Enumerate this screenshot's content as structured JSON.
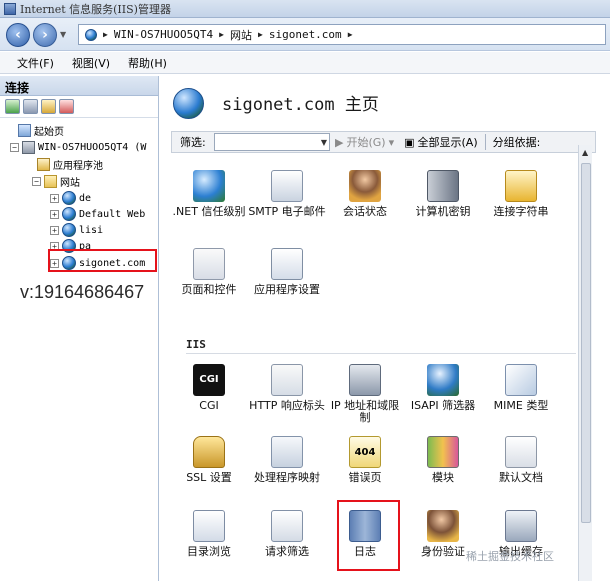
{
  "window": {
    "title": "Internet 信息服务(IIS)管理器"
  },
  "address": {
    "crumbs": [
      "WIN-OS7HUOO5QT4",
      "网站",
      "sigonet.com"
    ]
  },
  "menu": [
    "文件(F)",
    "视图(V)",
    "帮助(H)"
  ],
  "connections": {
    "title": "连接",
    "tree": [
      {
        "label": "起始页",
        "icon": "start-page-icon"
      },
      {
        "label": "WIN-OS7HUOO5QT4 (W",
        "icon": "server-icon"
      },
      {
        "label": "应用程序池",
        "icon": "app-pool-icon"
      },
      {
        "label": "网站",
        "icon": "sites-folder-icon"
      },
      {
        "label": "de",
        "icon": "globe-icon"
      },
      {
        "label": "Default Web",
        "icon": "globe-icon"
      },
      {
        "label": "lisi",
        "icon": "globe-icon"
      },
      {
        "label": "pa",
        "icon": "globe-icon"
      },
      {
        "label": "sigonet.com",
        "icon": "globe-icon"
      }
    ]
  },
  "watermark": "v:19164686467",
  "page": {
    "title": "sigonet.com 主页"
  },
  "filter": {
    "label": "筛选:",
    "start": "开始(G)",
    "show_all": "全部显示(A)",
    "group_by": "分组依据:"
  },
  "aspnet_features": [
    {
      "label": ".NET 信任级别",
      "icon": "trust-level-icon"
    },
    {
      "label": "SMTP 电子邮件",
      "icon": "smtp-email-icon"
    },
    {
      "label": "会话状态",
      "icon": "session-state-icon"
    },
    {
      "label": "计算机密钥",
      "icon": "machine-key-icon"
    },
    {
      "label": "连接字符串",
      "icon": "connection-strings-icon"
    },
    {
      "label": "页面和控件",
      "icon": "pages-controls-icon"
    },
    {
      "label": "应用程序设置",
      "icon": "app-settings-icon"
    }
  ],
  "iis_section": "IIS",
  "iis_features": [
    {
      "label": "CGI",
      "icon": "cgi-icon"
    },
    {
      "label": "HTTP 响应标头",
      "icon": "http-headers-icon"
    },
    {
      "label": "IP 地址和域限制",
      "icon": "ip-restrictions-icon"
    },
    {
      "label": "ISAPI 筛选器",
      "icon": "isapi-filter-icon"
    },
    {
      "label": "MIME 类型",
      "icon": "mime-types-icon"
    },
    {
      "label": "SSL 设置",
      "icon": "ssl-lock-icon"
    },
    {
      "label": "处理程序映射",
      "icon": "handler-mappings-icon"
    },
    {
      "label": "错误页",
      "icon": "error-pages-icon"
    },
    {
      "label": "模块",
      "icon": "modules-icon"
    },
    {
      "label": "默认文档",
      "icon": "default-document-icon"
    },
    {
      "label": "目录浏览",
      "icon": "directory-browsing-icon"
    },
    {
      "label": "请求筛选",
      "icon": "request-filtering-icon"
    },
    {
      "label": "日志",
      "icon": "logging-icon"
    },
    {
      "label": "身份验证",
      "icon": "authentication-icon"
    },
    {
      "label": "输出缓存",
      "icon": "output-caching-icon"
    }
  ],
  "footer_mark": "稀土掘金技术社区"
}
